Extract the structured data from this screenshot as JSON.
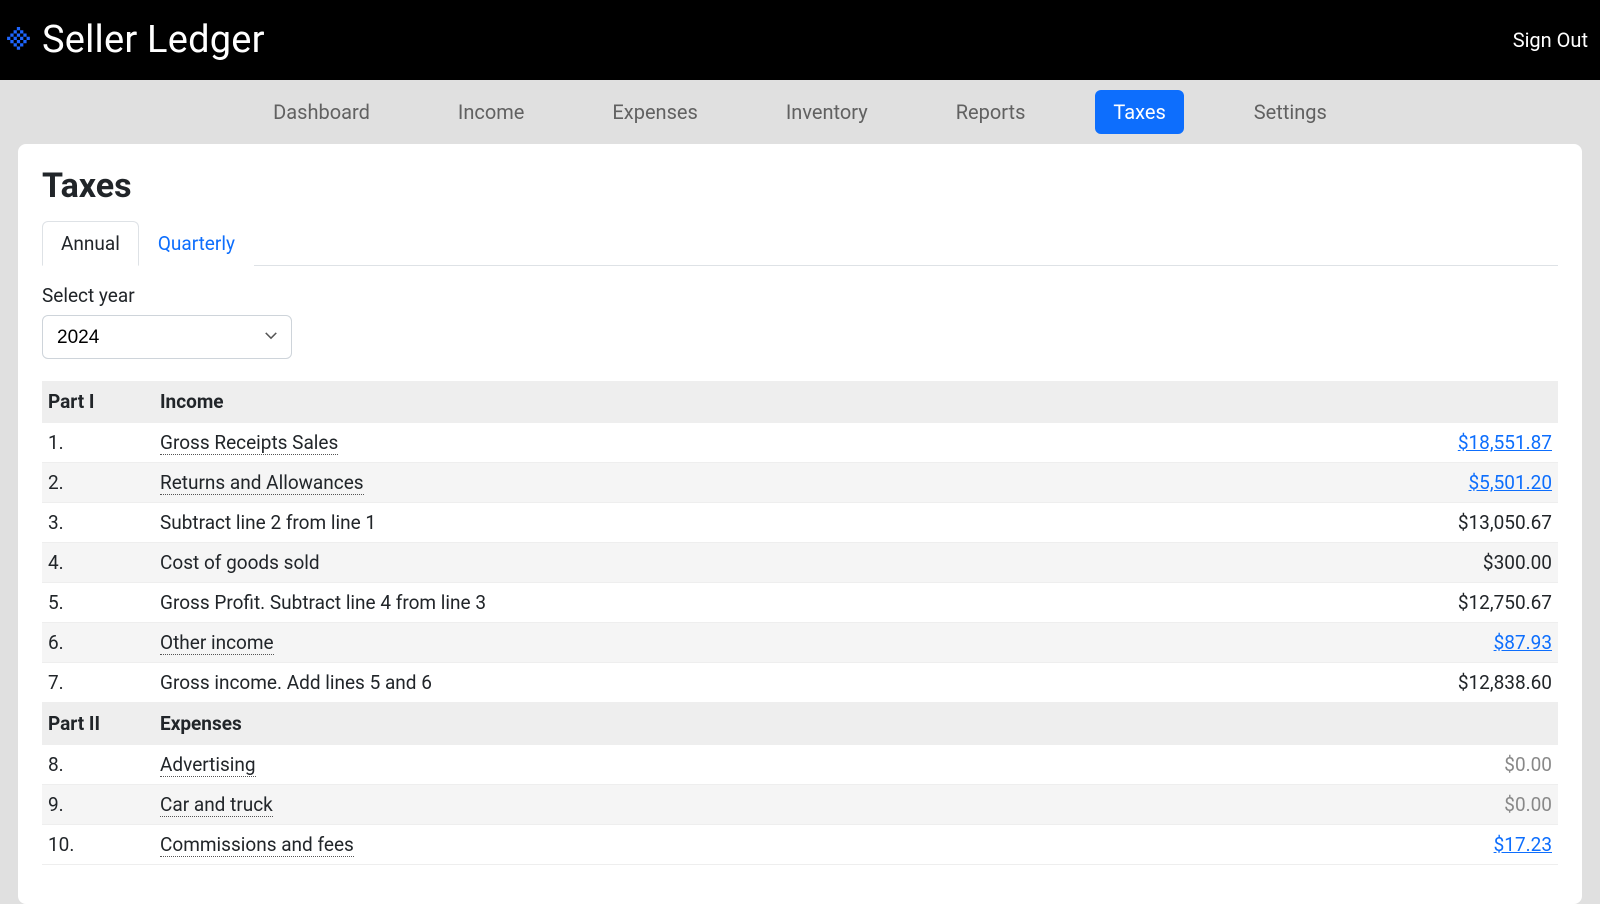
{
  "header": {
    "brand": "Seller Ledger",
    "signout": "Sign Out"
  },
  "nav": {
    "items": [
      {
        "label": "Dashboard",
        "active": false
      },
      {
        "label": "Income",
        "active": false
      },
      {
        "label": "Expenses",
        "active": false
      },
      {
        "label": "Inventory",
        "active": false
      },
      {
        "label": "Reports",
        "active": false
      },
      {
        "label": "Taxes",
        "active": true
      },
      {
        "label": "Settings",
        "active": false
      }
    ]
  },
  "page": {
    "title": "Taxes",
    "tabs": [
      {
        "label": "Annual",
        "active": true
      },
      {
        "label": "Quarterly",
        "active": false
      }
    ],
    "year_label": "Select year",
    "year_value": "2024"
  },
  "table": {
    "sections": [
      {
        "part": "Part I",
        "title": "Income"
      },
      {
        "part": "Part II",
        "title": "Expenses"
      }
    ],
    "rows": [
      {
        "num": "1.",
        "label": "Gross Receipts Sales",
        "dotted": true,
        "value": "$18,551.87",
        "link": true,
        "grey": false,
        "alt": false,
        "section": 0
      },
      {
        "num": "2.",
        "label": "Returns and Allowances",
        "dotted": true,
        "value": "$5,501.20",
        "link": true,
        "grey": false,
        "alt": true,
        "section": 0
      },
      {
        "num": "3.",
        "label": "Subtract line 2 from line 1",
        "dotted": false,
        "value": "$13,050.67",
        "link": false,
        "grey": false,
        "alt": false,
        "section": 0
      },
      {
        "num": "4.",
        "label": "Cost of goods sold",
        "dotted": false,
        "value": "$300.00",
        "link": false,
        "grey": false,
        "alt": true,
        "section": 0
      },
      {
        "num": "5.",
        "label": "Gross Profit. Subtract line 4 from line 3",
        "dotted": false,
        "value": "$12,750.67",
        "link": false,
        "grey": false,
        "alt": false,
        "section": 0
      },
      {
        "num": "6.",
        "label": "Other income",
        "dotted": true,
        "value": "$87.93",
        "link": true,
        "grey": false,
        "alt": true,
        "section": 0
      },
      {
        "num": "7.",
        "label": "Gross income. Add lines 5 and 6",
        "dotted": false,
        "value": "$12,838.60",
        "link": false,
        "grey": false,
        "alt": false,
        "section": 0
      },
      {
        "num": "8.",
        "label": "Advertising",
        "dotted": true,
        "value": "$0.00",
        "link": false,
        "grey": true,
        "alt": false,
        "section": 1
      },
      {
        "num": "9.",
        "label": "Car and truck",
        "dotted": true,
        "value": "$0.00",
        "link": false,
        "grey": true,
        "alt": true,
        "section": 1
      },
      {
        "num": "10.",
        "label": "Commissions and fees",
        "dotted": true,
        "value": "$17.23",
        "link": true,
        "grey": false,
        "alt": false,
        "section": 1
      }
    ]
  }
}
